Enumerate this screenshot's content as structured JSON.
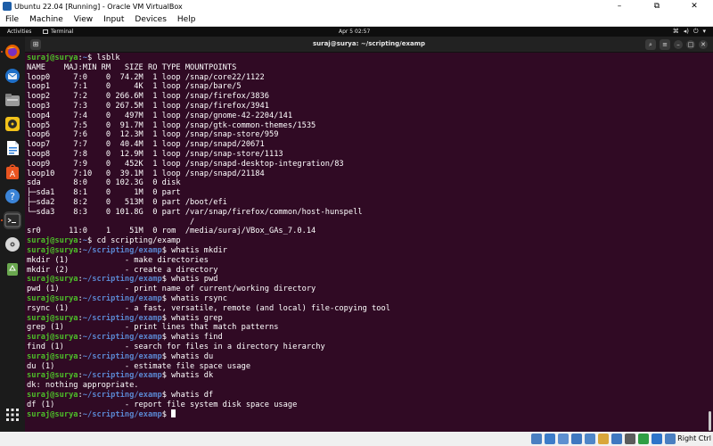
{
  "host_window": {
    "title": "Ubuntu 22.04 [Running] - Oracle VM VirtualBox",
    "controls": {
      "minimize": "–",
      "maximize": "⧉",
      "close": "✕"
    }
  },
  "host_menu": [
    "File",
    "Machine",
    "View",
    "Input",
    "Devices",
    "Help"
  ],
  "gnome_topbar": {
    "activities": "Activities",
    "app_name": "Terminal",
    "clock": "Apr 5  02:57",
    "tray": {
      "network": "⌘",
      "volume": "◂)",
      "power": "⏻",
      "menu": "▾"
    }
  },
  "dock": {
    "items": [
      {
        "name": "firefox",
        "color": "#e66000"
      },
      {
        "name": "thunderbird",
        "color": "#1f6fc7"
      },
      {
        "name": "files",
        "color": "#9a9a9a"
      },
      {
        "name": "rhythmbox",
        "color": "#f2c21a"
      },
      {
        "name": "libreoffice-writer",
        "color": "#2f7fd8"
      },
      {
        "name": "ubuntu-software",
        "color": "#e95420"
      },
      {
        "name": "help",
        "color": "#3b84d8"
      },
      {
        "name": "terminal",
        "color": "#3a3a3a"
      },
      {
        "name": "cd-drive",
        "color": "#d8d8d8"
      },
      {
        "name": "trash",
        "color": "#6aa84f"
      }
    ],
    "show_apps": "⋮⋮⋮"
  },
  "terminal": {
    "title": "suraj@surya: ~/scripting/examp",
    "buttons": {
      "new_tab": "⊞",
      "search": "⌕",
      "menu": "≡",
      "minimize": "–",
      "maximize": "□",
      "close": "✕"
    },
    "lines": [
      {
        "user": "suraj@surya",
        "path": "~",
        "cmd": "lsblk"
      },
      {
        "text": "NAME    MAJ:MIN RM   SIZE RO TYPE MOUNTPOINTS"
      },
      {
        "text": "loop0     7:0    0  74.2M  1 loop /snap/core22/1122"
      },
      {
        "text": "loop1     7:1    0     4K  1 loop /snap/bare/5"
      },
      {
        "text": "loop2     7:2    0 266.6M  1 loop /snap/firefox/3836"
      },
      {
        "text": "loop3     7:3    0 267.5M  1 loop /snap/firefox/3941"
      },
      {
        "text": "loop4     7:4    0   497M  1 loop /snap/gnome-42-2204/141"
      },
      {
        "text": "loop5     7:5    0  91.7M  1 loop /snap/gtk-common-themes/1535"
      },
      {
        "text": "loop6     7:6    0  12.3M  1 loop /snap/snap-store/959"
      },
      {
        "text": "loop7     7:7    0  40.4M  1 loop /snap/snapd/20671"
      },
      {
        "text": "loop8     7:8    0  12.9M  1 loop /snap/snap-store/1113"
      },
      {
        "text": "loop9     7:9    0   452K  1 loop /snap/snapd-desktop-integration/83"
      },
      {
        "text": "loop10    7:10   0  39.1M  1 loop /snap/snapd/21184"
      },
      {
        "text": "sda       8:0    0 102.3G  0 disk"
      },
      {
        "text": "├─sda1    8:1    0     1M  0 part"
      },
      {
        "text": "├─sda2    8:2    0   513M  0 part /boot/efi"
      },
      {
        "text": "└─sda3    8:3    0 101.8G  0 part /var/snap/firefox/common/host-hunspell"
      },
      {
        "text": "                                   /"
      },
      {
        "text": "sr0      11:0    1    51M  0 rom  /media/suraj/VBox_GAs_7.0.14"
      },
      {
        "user": "suraj@surya",
        "path": "~",
        "cmd": "cd scripting/examp"
      },
      {
        "user": "suraj@surya",
        "path": "~/scripting/examp",
        "cmd": "whatis mkdir"
      },
      {
        "text": "mkdir (1)            - make directories"
      },
      {
        "text": "mkdir (2)            - create a directory"
      },
      {
        "user": "suraj@surya",
        "path": "~/scripting/examp",
        "cmd": "whatis pwd"
      },
      {
        "text": "pwd (1)              - print name of current/working directory"
      },
      {
        "user": "suraj@surya",
        "path": "~/scripting/examp",
        "cmd": "whatis rsync"
      },
      {
        "text": "rsync (1)            - a fast, versatile, remote (and local) file-copying tool"
      },
      {
        "user": "suraj@surya",
        "path": "~/scripting/examp",
        "cmd": "whatis grep"
      },
      {
        "text": "grep (1)             - print lines that match patterns"
      },
      {
        "user": "suraj@surya",
        "path": "~/scripting/examp",
        "cmd": "whatis find"
      },
      {
        "text": "find (1)             - search for files in a directory hierarchy"
      },
      {
        "user": "suraj@surya",
        "path": "~/scripting/examp",
        "cmd": "whatis du"
      },
      {
        "text": "du (1)               - estimate file space usage"
      },
      {
        "user": "suraj@surya",
        "path": "~/scripting/examp",
        "cmd": "whatis dk"
      },
      {
        "text": "dk: nothing appropriate."
      },
      {
        "user": "suraj@surya",
        "path": "~/scripting/examp",
        "cmd": "whatis df"
      },
      {
        "text": "df (1)               - report file system disk space usage"
      },
      {
        "user": "suraj@surya",
        "path": "~/scripting/examp",
        "cmd": "",
        "cursor": true
      }
    ]
  },
  "vbox_statusbar": {
    "host_key": "Right Ctrl",
    "icons": [
      {
        "name": "hard-disk",
        "color": "#4a7fc1"
      },
      {
        "name": "optical-drive",
        "color": "#3d7cc9"
      },
      {
        "name": "audio",
        "color": "#5d8fd0"
      },
      {
        "name": "network",
        "color": "#3f78c0"
      },
      {
        "name": "usb",
        "color": "#4f86c8"
      },
      {
        "name": "shared-folders",
        "color": "#d9a63a"
      },
      {
        "name": "display",
        "color": "#3f78c0"
      },
      {
        "name": "recording",
        "color": "#5b5b5b"
      },
      {
        "name": "cpu",
        "color": "#2f9e44"
      },
      {
        "name": "arrow-down",
        "color": "#2e74c9"
      },
      {
        "name": "mouse-integration",
        "color": "#4a7fc1"
      }
    ]
  }
}
